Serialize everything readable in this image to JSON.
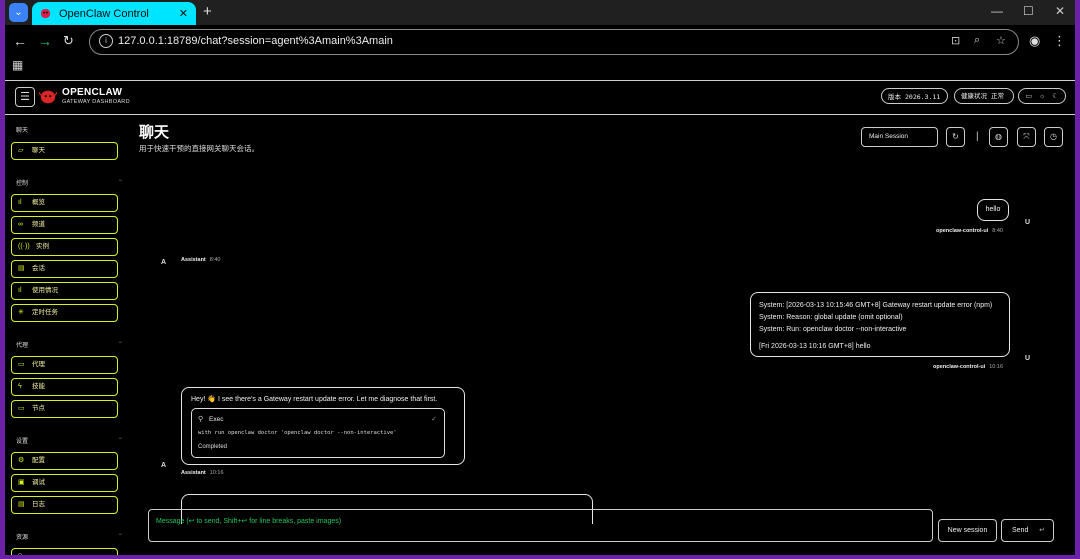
{
  "browser": {
    "tab_title": "OpenClaw Control",
    "tab_close": "✕",
    "new_tab": "+",
    "url": "127.0.0.1:18789/chat?session=agent%3Amain%3Amain"
  },
  "header": {
    "brand": "OPENCLAW",
    "brand_sub": "GATEWAY DASHBOARD",
    "version_label": "版本",
    "version_value": "2026.3.11",
    "health_label": "健康状况",
    "health_value": "正常"
  },
  "sidebar": {
    "sections": [
      {
        "title": "聊天",
        "items": [
          {
            "label": "聊天",
            "icon": "chat-icon"
          }
        ]
      },
      {
        "title": "控制",
        "items": [
          {
            "label": "概览",
            "icon": "bar-chart-icon"
          },
          {
            "label": "频道",
            "icon": "link-icon"
          },
          {
            "label": "实例",
            "icon": "radio-icon"
          },
          {
            "label": "会话",
            "icon": "document-icon"
          },
          {
            "label": "使用情况",
            "icon": "bar-chart-icon"
          },
          {
            "label": "定时任务",
            "icon": "loader-icon"
          }
        ]
      },
      {
        "title": "代理",
        "items": [
          {
            "label": "代理",
            "icon": "folder-icon"
          },
          {
            "label": "技能",
            "icon": "zap-icon"
          },
          {
            "label": "节点",
            "icon": "monitor-icon"
          }
        ]
      },
      {
        "title": "设置",
        "items": [
          {
            "label": "配置",
            "icon": "settings-icon"
          },
          {
            "label": "调试",
            "icon": "bug-icon"
          },
          {
            "label": "日志",
            "icon": "file-text-icon"
          }
        ]
      },
      {
        "title": "资源",
        "items": [
          {
            "label": "",
            "icon": "book-icon"
          }
        ]
      }
    ]
  },
  "main": {
    "title": "聊天",
    "subtitle": "用于快速干预的直接网关聊天会话。",
    "session_select": "Main Session"
  },
  "messages": [
    {
      "role": "user",
      "text": "hello",
      "sender": "openclaw-control-ui",
      "time": "8:40",
      "avatar": "U"
    },
    {
      "role": "assistant",
      "sender": "Assistant",
      "time": "8:40",
      "avatar": "A"
    },
    {
      "role": "user",
      "lines": [
        "System: [2026-03-13 10:15:46 GMT+8] Gateway restart update error (npm)",
        "System: Reason: global update (omit optional)",
        "System: Run: openclaw doctor --non-interactive",
        "[Fri 2026-03-13 10:16 GMT+8] hello"
      ],
      "sender": "openclaw-control-ui",
      "time": "10:16",
      "avatar": "U"
    },
    {
      "role": "assistant",
      "text": "Hey! 👋 I see there's a Gateway restart update error. Let me diagnose that first.",
      "tool": {
        "name": "Exec",
        "command": "with run openclaw doctor 'openclaw doctor --non-interactive'",
        "status": "Completed"
      },
      "sender": "Assistant",
      "time": "10:16",
      "avatar": "A"
    }
  ],
  "composer": {
    "placeholder": "Message (↩ to send, Shift+↩ for line breaks, paste images)",
    "new_session": "New session",
    "send": "Send"
  }
}
